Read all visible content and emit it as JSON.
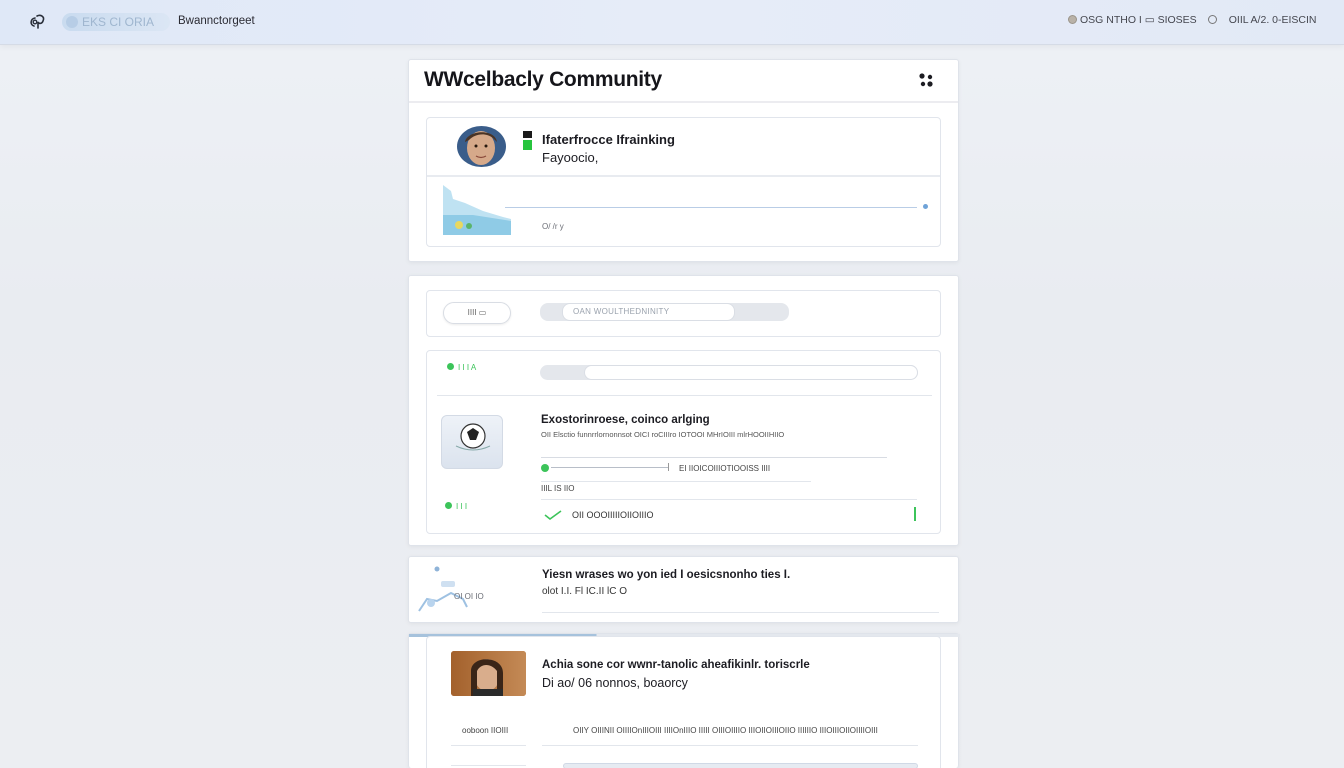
{
  "topbar": {
    "brand_pill": "EKS CI ORIA",
    "app_name": "Bwannctorgeet",
    "status_left": "OSG NTHO I ▭ SIOSES",
    "status_right": "OIIL A/2. 0-EISCIN"
  },
  "community": {
    "title": "WWcelbacly  Community",
    "post1": {
      "line1": "Ifaterfrocce  Ifrainking",
      "line2": "Fayoocio,",
      "meta": "O/ /r y"
    }
  },
  "filters": {
    "button_label": "IIII ▭",
    "search_placeholder": "OAN WOULTHEDNINITY"
  },
  "feed": {
    "status1": "I I I A",
    "status2": "I I I",
    "item": {
      "title": "Exostorinroese, coinco arlging",
      "subtitle": "OII  Elsctio   funnrrlornonnsot  OICI  roCIIIro  IOTOOI  MHrIOIII mlrHOOIIHIIO",
      "progress_label": "EI IIOICOIIIOTIOOISS  IIII",
      "progress": 0.25,
      "date": "IIIL IS  IIO",
      "footer": "OII  OOOIIIIIOIIOIIIO"
    }
  },
  "reply": {
    "image_caption": "OI   OI   IO",
    "line1": "Yiesn wrases wo yon ied I oesicsnonho ties I.",
    "line2": "olot  I.I.  Fl IC.II  lC  O"
  },
  "story": {
    "line1": "Achia sone cor  wwnr-tanolic aheafikinlr. toriscrle",
    "line2": "Di ao/ 06 nonnos, boaorcy",
    "author": "ooboon  IIOIII",
    "snippet": "OIIY  OIIINII  OIIIIOnIIIOIII  IIIIOnIIIO  IIIII OIIIOIIIIO  IIIOIIOIIIOIIO  IIIIIIO  IIIOIIIOIIOIIIIOIII"
  },
  "colors": {
    "accent_green": "#3cc45a",
    "topbar_bg": "#dfe8f7"
  }
}
